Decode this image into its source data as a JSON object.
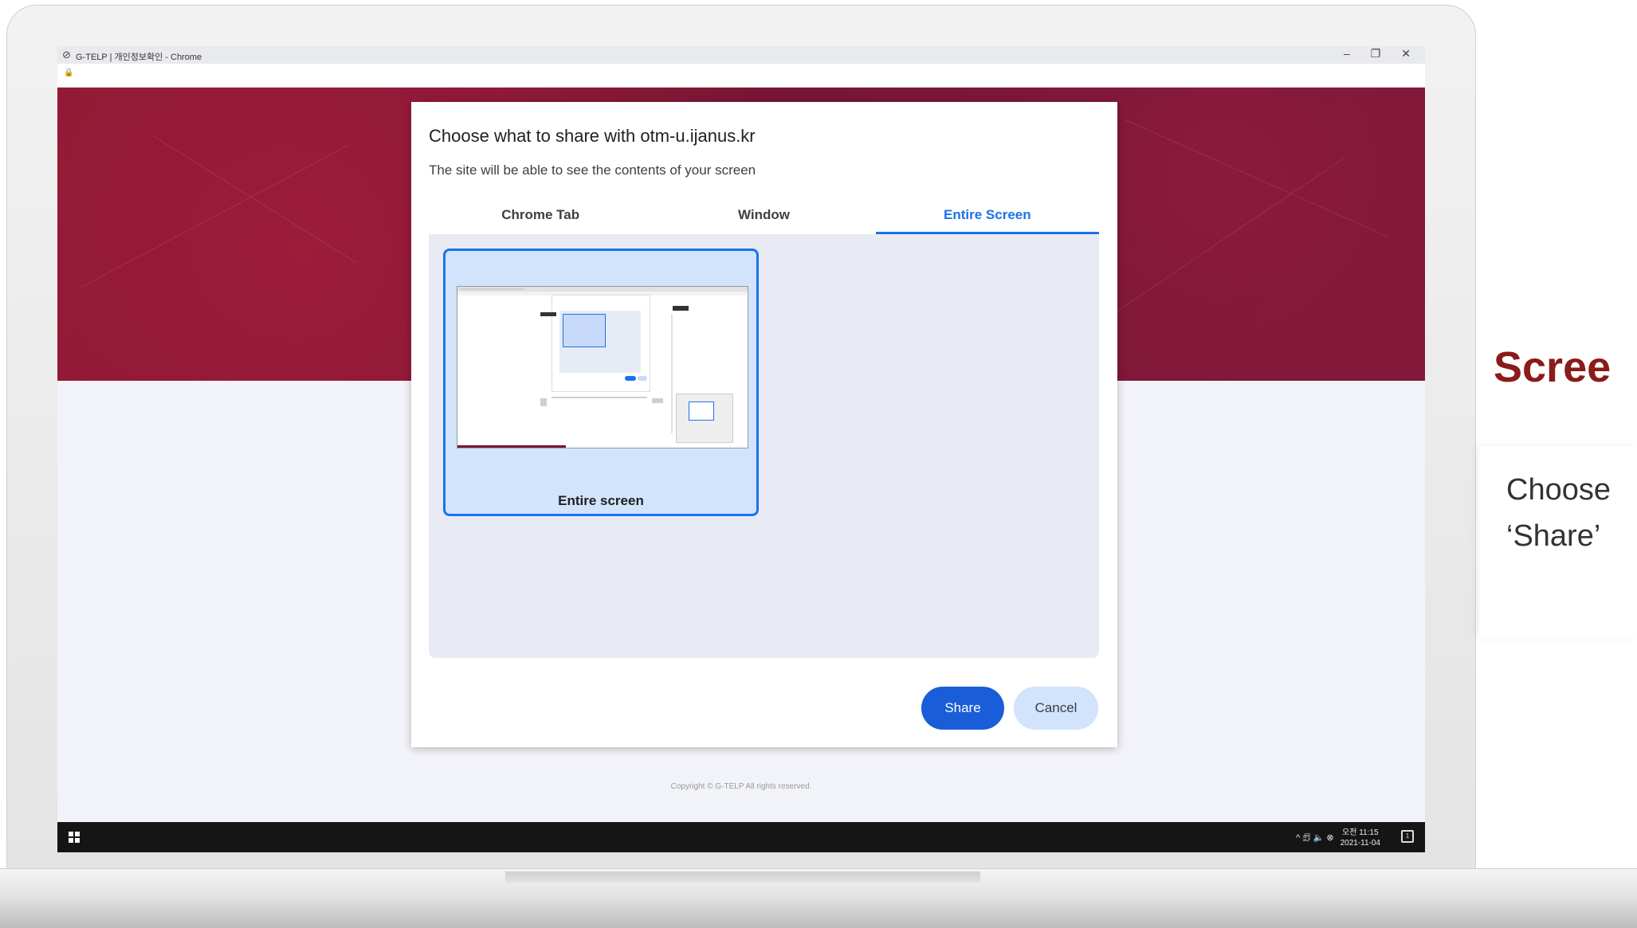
{
  "window": {
    "title": "G-TELP | 개인정보확인 - Chrome",
    "controls": [
      "–",
      "❐",
      "✕"
    ]
  },
  "dialog": {
    "title": "Choose what to share with otm-u.ijanus.kr",
    "subtitle": "The site will be able to see the contents of your screen",
    "tabs": [
      {
        "label": "Chrome Tab",
        "active": false
      },
      {
        "label": "Window",
        "active": false
      },
      {
        "label": "Entire Screen",
        "active": true
      }
    ],
    "source_label": "Entire screen",
    "share_label": "Share",
    "cancel_label": "Cancel"
  },
  "page": {
    "copyright": "Copyright © G-TELP All rights reserved."
  },
  "taskbar": {
    "tray_icons": "^ 🗊 🔈 ⊗",
    "time": "오전 11:15",
    "date": "2021-11-04"
  },
  "side": {
    "title": "Scree",
    "line1": "Choose",
    "line2": "‘Share’"
  },
  "colors": {
    "accent": "#1a73e8",
    "banner": "#7a1635",
    "side_title": "#8b1a1a"
  }
}
